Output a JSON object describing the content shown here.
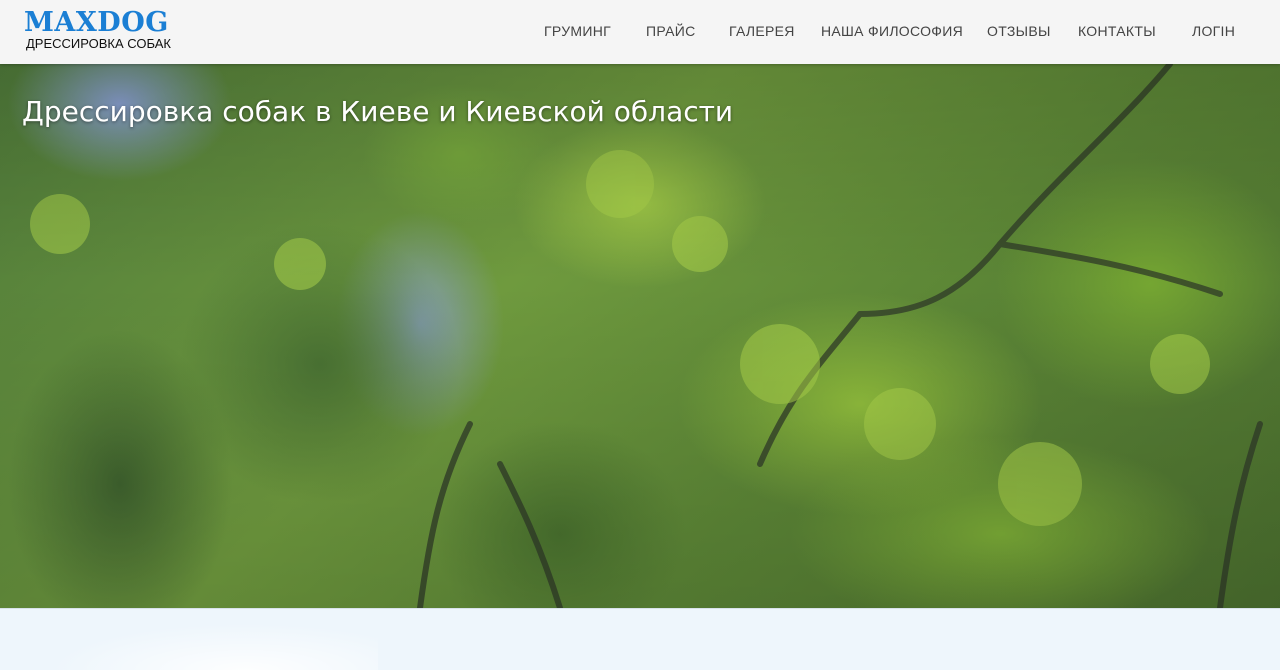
{
  "logo": {
    "title": "MAXDOG",
    "subtitle": "ДРЕССИРОВКА СОБАК"
  },
  "nav": {
    "items": [
      {
        "label": "ГРУМИНГ"
      },
      {
        "label": "ПРАЙС"
      },
      {
        "label": "ГАЛЕРЕЯ"
      },
      {
        "label": "НАША ФИЛОСОФИЯ"
      },
      {
        "label": "ОТЗЫВЫ"
      },
      {
        "label": "КОНТАКТЫ"
      },
      {
        "label": "ЛОГІН"
      }
    ]
  },
  "hero": {
    "title": "Дрессировка собак в Киеве и Киевской области"
  },
  "colors": {
    "brand": "#1b7fd4",
    "header_bg": "#f5f5f5",
    "nav_text": "#444444",
    "page_bg": "#eef6fc"
  }
}
